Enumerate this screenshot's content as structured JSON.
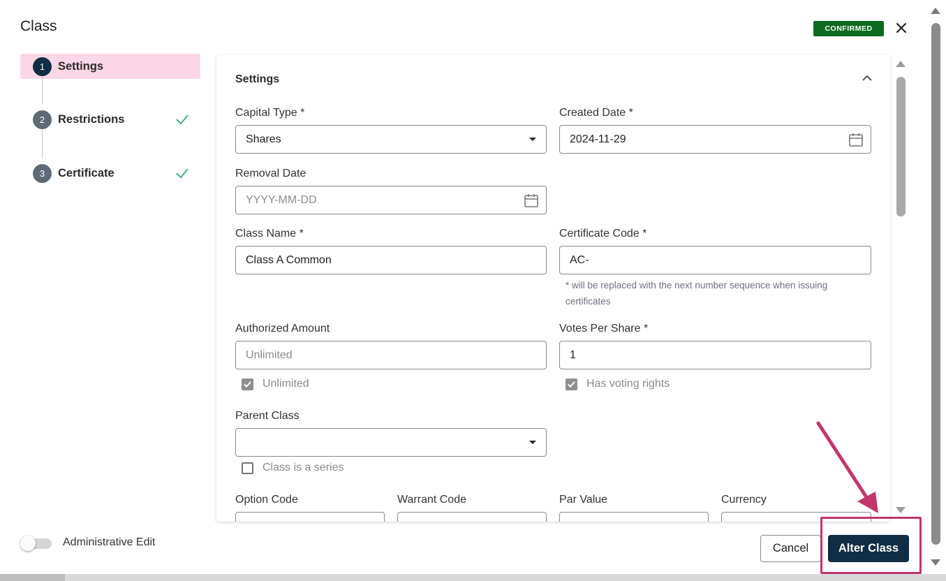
{
  "dialog": {
    "title": "Class",
    "status_badge": "CONFIRMED"
  },
  "steps": [
    {
      "number": "1",
      "label": "Settings",
      "state": "active"
    },
    {
      "number": "2",
      "label": "Restrictions",
      "state": "complete"
    },
    {
      "number": "3",
      "label": "Certificate",
      "state": "complete"
    }
  ],
  "settings": {
    "section_title": "Settings",
    "capital_type": {
      "label": "Capital Type",
      "required": "*",
      "value": "Shares"
    },
    "created_date": {
      "label": "Created Date",
      "required": "*",
      "value": "2024-11-29"
    },
    "removal_date": {
      "label": "Removal Date",
      "placeholder": "YYYY-MM-DD"
    },
    "class_name": {
      "label": "Class Name",
      "required": "*",
      "value": "Class A Common"
    },
    "certificate_code": {
      "label": "Certificate Code",
      "required": "*",
      "value": "AC-",
      "helper": "* will be replaced with the next number sequence when issuing certificates"
    },
    "authorized_amount": {
      "label": "Authorized Amount",
      "placeholder": "Unlimited"
    },
    "unlimited_checkbox": {
      "label": "Unlimited",
      "checked": true
    },
    "votes_per_share": {
      "label": "Votes Per Share",
      "required": "*",
      "value": "1"
    },
    "voting_rights_checkbox": {
      "label": "Has voting rights",
      "checked": true
    },
    "parent_class": {
      "label": "Parent Class",
      "value": ""
    },
    "series_checkbox": {
      "label": "Class is a series",
      "checked": false
    },
    "option_code": {
      "label": "Option Code"
    },
    "warrant_code": {
      "label": "Warrant Code"
    },
    "par_value": {
      "label": "Par Value"
    },
    "currency": {
      "label": "Currency"
    }
  },
  "footer": {
    "admin_edit_label": "Administrative Edit",
    "admin_edit_on": false,
    "cancel_label": "Cancel",
    "submit_label": "Alter Class"
  },
  "colors": {
    "primary": "#0f2d44",
    "badge_green": "#0b6b1f",
    "active_step_bg": "#fcd7e6",
    "check_green": "#3fb07a",
    "annotation": "#c2366d"
  }
}
